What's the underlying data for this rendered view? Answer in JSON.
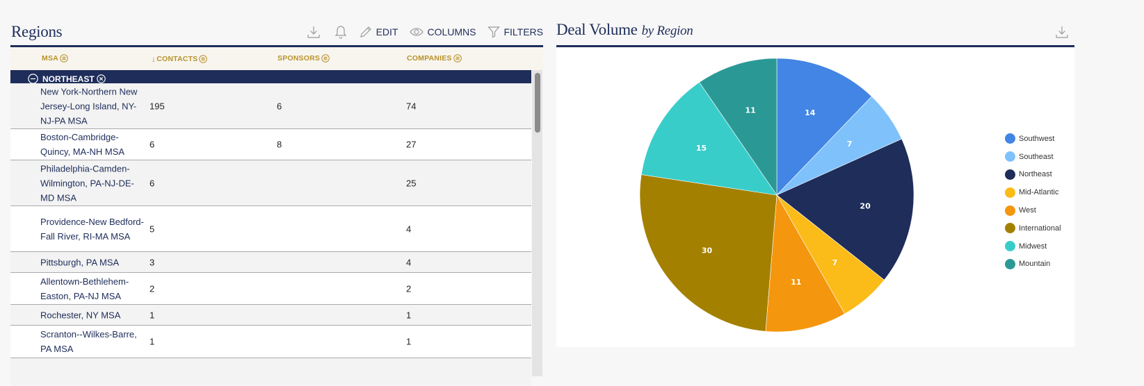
{
  "regions_panel": {
    "title": "Regions",
    "toolbar": {
      "download_icon": "download-icon",
      "bell_icon": "bell-icon",
      "edit_label": "EDIT",
      "columns_label": "COLUMNS",
      "filters_label": "FILTERS"
    },
    "columns": [
      {
        "label": "MSA",
        "sort": "",
        "menu_icon": "column-menu-icon"
      },
      {
        "label": "CONTACTS",
        "sort": "descending",
        "sort_glyph": "↓",
        "menu_icon": "column-menu-icon"
      },
      {
        "label": "SPONSORS",
        "sort": "",
        "menu_icon": "column-menu-icon"
      },
      {
        "label": "COMPANIES",
        "sort": "",
        "menu_icon": "column-menu-icon"
      }
    ],
    "group": {
      "label": "NORTHEAST",
      "expanded": true
    },
    "rows": [
      {
        "msa": "New York-Northern New Jersey-Long Island, NY-NJ-PA MSA",
        "contacts": "195",
        "sponsors": "6",
        "companies": "74"
      },
      {
        "msa": "Boston-Cambridge-Quincy, MA-NH MSA",
        "contacts": "6",
        "sponsors": "8",
        "companies": "27"
      },
      {
        "msa": "Philadelphia-Camden-Wilmington, PA-NJ-DE-MD MSA",
        "contacts": "6",
        "sponsors": "",
        "companies": "25"
      },
      {
        "msa": "Providence-New Bedford-Fall River, RI-MA MSA",
        "contacts": "5",
        "sponsors": "",
        "companies": "4"
      },
      {
        "msa": "Pittsburgh, PA MSA",
        "contacts": "3",
        "sponsors": "",
        "companies": "4"
      },
      {
        "msa": "Allentown-Bethlehem-Easton, PA-NJ MSA",
        "contacts": "2",
        "sponsors": "",
        "companies": "2"
      },
      {
        "msa": "Rochester, NY MSA",
        "contacts": "1",
        "sponsors": "",
        "companies": "1"
      },
      {
        "msa": "Scranton--Wilkes-Barre, PA MSA",
        "contacts": "1",
        "sponsors": "",
        "companies": "1"
      }
    ]
  },
  "deal_panel": {
    "title": "Deal Volume",
    "subtitle": "by Region",
    "download_icon": "download-icon"
  },
  "colors": {
    "navy": "#1e2d5a",
    "gold": "#b8912b"
  },
  "chart_data": {
    "type": "pie",
    "title": "Deal Volume by Region",
    "start": "12 o'clock, clockwise",
    "legend_position": "right",
    "slices": [
      {
        "label": "Southwest",
        "value": 14,
        "color": "#4285e4"
      },
      {
        "label": "Southeast",
        "value": 7,
        "color": "#7fc2fb"
      },
      {
        "label": "Northeast",
        "value": 20,
        "color": "#1e2d5a"
      },
      {
        "label": "Mid-Atlantic",
        "value": 7,
        "color": "#fbbb19"
      },
      {
        "label": "West",
        "value": 11,
        "color": "#f4960e"
      },
      {
        "label": "International",
        "value": 30,
        "color": "#a48000"
      },
      {
        "label": "Midwest",
        "value": 15,
        "color": "#39cdca"
      },
      {
        "label": "Mountain",
        "value": 11,
        "color": "#2a9996"
      }
    ]
  }
}
